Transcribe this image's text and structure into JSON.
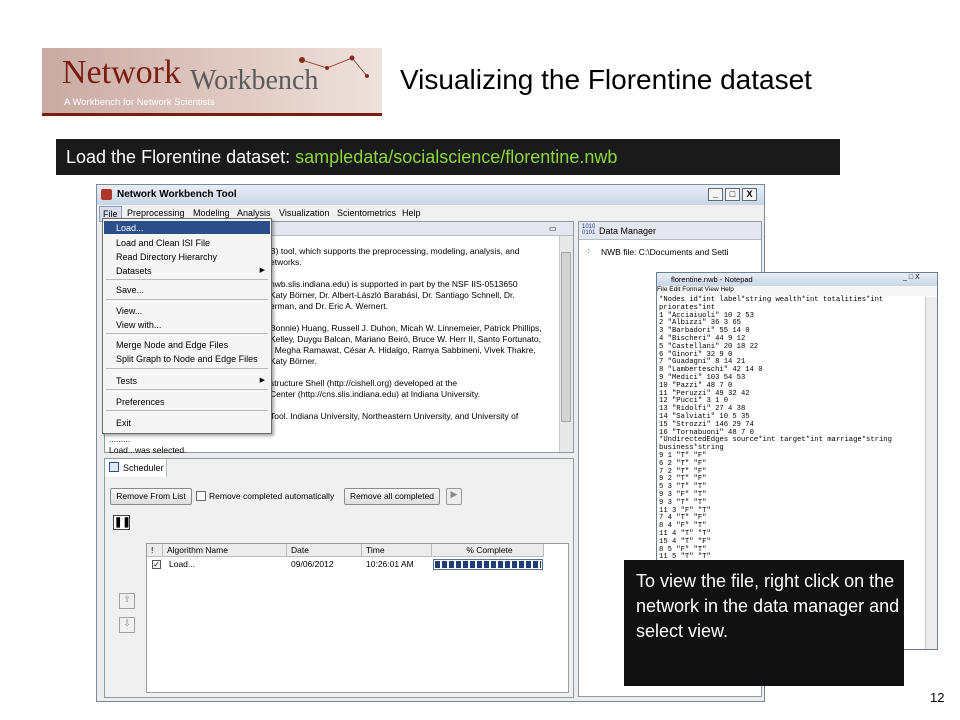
{
  "logo": {
    "word1": "Network",
    "word2": "Workbench",
    "tagline": "A Workbench for Network Scientists"
  },
  "slide": {
    "title": "Visualizing the Florentine dataset",
    "page_number": "12"
  },
  "banner": {
    "prefix": "Load the Florentine dataset:",
    "path": "sampledata/socialscience/florentine.nwb"
  },
  "window": {
    "title": "Network Workbench Tool",
    "min": "_",
    "max": "□",
    "close": "X"
  },
  "menubar": [
    "File",
    "Preprocessing",
    "Modeling",
    "Analysis",
    "Visualization",
    "Scientometrics",
    "Help"
  ],
  "file_menu": {
    "load": "Load...",
    "load_isi": "Load and Clean ISI File",
    "read_dir": "Read Directory Hierarchy",
    "datasets": "Datasets",
    "save": "Save...",
    "view": "View...",
    "view_with": "View with...",
    "merge": "Merge Node and Edge Files",
    "split": "Split Graph to Node and Edge Files",
    "tests": "Tests",
    "preferences": "Preferences",
    "exit": "Exit"
  },
  "console": {
    "lines": [
      "B) tool, which supports the preprocessing, modeling, analysis, and",
      "etworks.",
      "",
      "nwb.slis.indiana.edu) is supported in part by the NSF IIS-0513650",
      "Katy Börner, Dr. Albert-László Barabási, Dr. Santiago Schnell, Dr.",
      "erman, and Dr. Eric A. Wernert.",
      "",
      "Bonnie) Huang, Russell J. Duhon, Micah W. Linnemeier, Patrick Phillips,",
      "Kelley, Duygu Balcan, Mariano Beiró, Bruce W. Herr II, Santo Fortunato,",
      ", Megha Ramawat, César A. Hidalgo, Ramya Sabbineni, Vivek Thakre,",
      "Katy Börner.",
      "",
      "structure Shell (http://cishell.org) developed at the",
      "Center (http://cns.slis.indiana.edu) at Indiana University.",
      "",
      "Tool. Indiana University, Northeastern University, and University of"
    ],
    "left_lines": [
      ".........",
      "Load...was selected."
    ]
  },
  "data_manager": {
    "tab": "Data Manager",
    "node": "NWB file: C:\\Documents and Setti"
  },
  "scheduler": {
    "tab": "Scheduler",
    "remove_btn": "Remove From List",
    "auto_label": "Remove completed automatically",
    "remove_all_btn": "Remove all completed",
    "columns": [
      "!",
      "Algorithm Name",
      "Date",
      "Time",
      "% Complete"
    ],
    "row": {
      "name": "Load...",
      "date": "09/06/2012",
      "time": "10:26:01 AM",
      "complete": 1.0
    }
  },
  "notepad": {
    "title": "florentine.nwb - Notepad",
    "menu": "File   Edit   Format   View   Help",
    "text": "*Nodes id*int label*string wealth*int totalities*int\npriorates*int\n1 \"Acciaiuoli\" 10 2 53\n2 \"Albizzi\" 36 3 65\n3 \"Barbadori\" 55 14 0\n4 \"Bischeri\" 44 9 12\n5 \"Castellani\" 20 18 22\n6 \"Ginori\" 32 9 0\n7 \"Guadagni\" 8 14 21\n8 \"Lamberteschi\" 42 14 0\n9 \"Medici\" 103 54 53\n10 \"Pazzi\" 48 7 0\n11 \"Peruzzi\" 49 32 42\n12 \"Pucci\" 3 1 0\n13 \"Ridolfi\" 27 4 38\n14 \"Salviati\" 10 5 35\n15 \"Strozzi\" 146 29 74\n16 \"Tornabuoni\" 48 7 0\n*UndirectedEdges source*int target*int marriage*string\nbusiness*string\n9 1 \"T\" \"F\"\n6 2 \"T\" \"F\"\n7 2 \"T\" \"F\"\n9 2 \"T\" \"F\"\n5 3 \"T\" \"T\"\n9 3 \"F\" \"T\"\n9 3 \"T\" \"T\"\n11 3 \"F\" \"T\"\n7 4 \"T\" \"F\"\n8 4 \"F\" \"T\"\n11 4 \"T\" \"T\"\n15 4 \"T\" \"F\"\n8 5 \"F\" \"T\"\n11 5 \"T\" \"T\"\n15 5 \"T\" \"F\"\n9 6 \"F\" \"T\""
  },
  "callout": "To view the file, right click on the network in the data manager and select view."
}
